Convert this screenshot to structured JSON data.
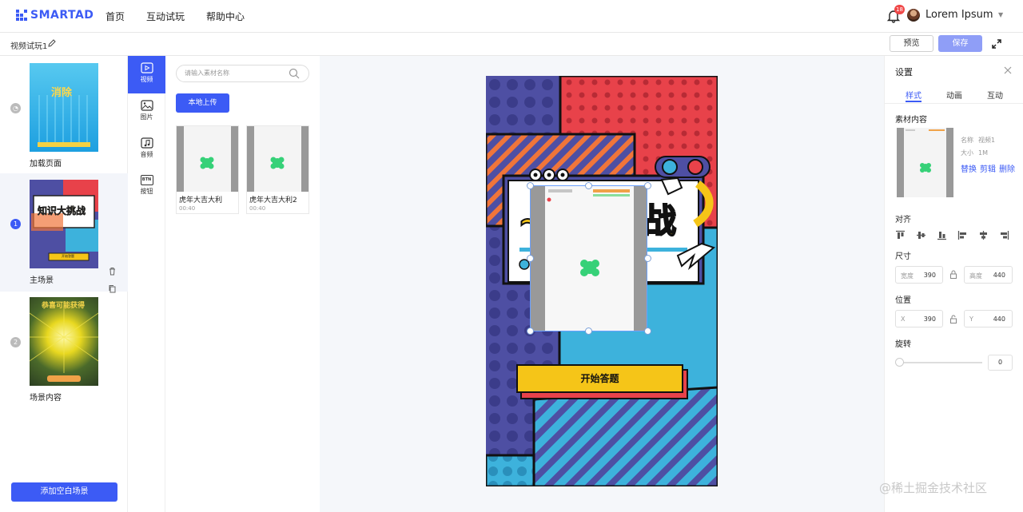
{
  "app": {
    "logo_text": "SMARTAD"
  },
  "nav": {
    "items": [
      "首页",
      "互动试玩",
      "帮助中心"
    ]
  },
  "user": {
    "notifications": "18",
    "name": "Lorem Ipsum"
  },
  "toolbar": {
    "doc_title": "视频试玩1",
    "preview_label": "预览",
    "save_label": "保存"
  },
  "scenes": {
    "items": [
      {
        "label": "加载页面",
        "thumb_text": "消除"
      },
      {
        "num": "1",
        "label": "主场景",
        "thumb_text": "知识大挑战",
        "thumb_btn": "开始答题"
      },
      {
        "num": "2",
        "label": "场景内容",
        "thumb_text": "恭喜可能获得"
      }
    ],
    "add_label": "添加空白场景"
  },
  "tabs": [
    {
      "label": "视频"
    },
    {
      "label": "图片"
    },
    {
      "label": "音频"
    },
    {
      "label": "按钮",
      "icon_text": "BTN"
    }
  ],
  "assets": {
    "search_placeholder": "请输入素材名称",
    "upload_label": "本地上传",
    "items": [
      {
        "name": "虎年大吉大利",
        "duration": "00:40"
      },
      {
        "name": "虎年大吉大利2",
        "duration": "00:40"
      }
    ]
  },
  "stage": {
    "title_visible": "战",
    "start_label": "开始答题"
  },
  "settings": {
    "title": "设置",
    "tabs": [
      "样式",
      "动画",
      "互动"
    ],
    "material_label": "素材内容",
    "meta": {
      "name_key": "名称",
      "name_value": "视频1",
      "size_key": "大小",
      "size_value": "1M"
    },
    "actions": [
      "替换",
      "剪辑",
      "删除"
    ],
    "align_label": "对齐",
    "size_label": "尺寸",
    "width_key": "宽度",
    "width_value": "390",
    "height_key": "高度",
    "height_value": "440",
    "position_label": "位置",
    "x_key": "X",
    "x_value": "390",
    "y_key": "Y",
    "y_value": "440",
    "rotation_label": "旋转",
    "rotation_value": "0"
  },
  "watermark": "@稀土掘金技术社区",
  "colors": {
    "accent": "#3c5bf5",
    "save_button": "#8f9ef7",
    "poster_red": "#e8424a",
    "poster_purple": "#4e4fa3",
    "poster_cyan": "#3db2dc",
    "poster_yellow": "#f5c518"
  }
}
